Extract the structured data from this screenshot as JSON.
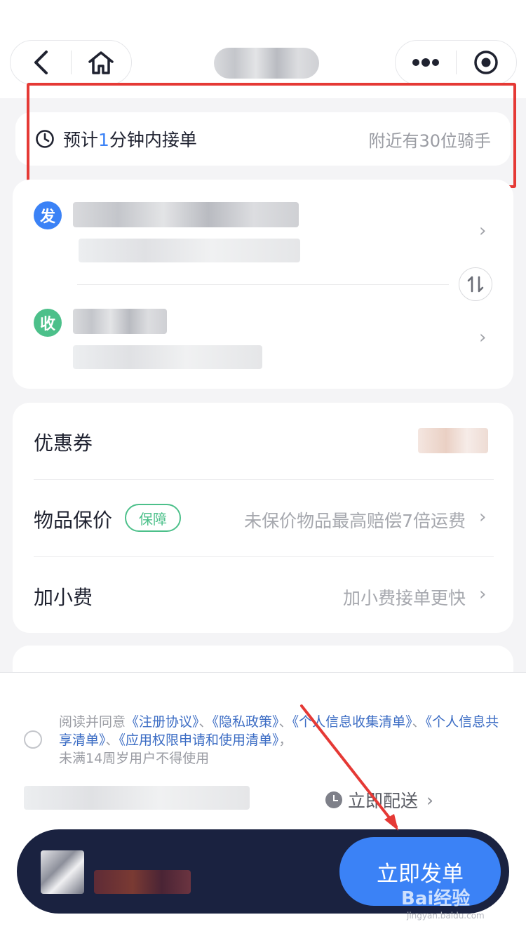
{
  "header": {
    "back_icon": "chevron-left-icon",
    "home_icon": "home-icon",
    "more_icon": "more-dots-icon",
    "target_icon": "target-icon"
  },
  "eta": {
    "prefix": "预计",
    "minutes": "1",
    "suffix": "分钟内接单",
    "nearby": "附近有30位骑手"
  },
  "address": {
    "send_badge": "发",
    "recv_badge": "收",
    "swap_icon": "swap-icon"
  },
  "options": {
    "coupon_label": "优惠券",
    "insurance_label": "物品保价",
    "insurance_tag": "保障",
    "insurance_hint": "未保价物品最高赔偿7倍运费",
    "tip_label": "加小费",
    "tip_hint": "加小费接单更快"
  },
  "agreement": {
    "lead": "阅读并同意",
    "link1": "《注册协议》",
    "sep1": "、",
    "link2": "《隐私政策》",
    "sep2": "、",
    "link3": "《个人信息收集清单》",
    "sep3": "、",
    "link4": "《个人信息共享清单》",
    "sep4": "、",
    "link5": "《应用权限申请和使用清单》",
    "tail": "，",
    "note": "未满14周岁用户不得使用"
  },
  "delivery": {
    "schedule_label": "立即配送",
    "submit_label": "立即发单"
  },
  "watermark": {
    "brand": "Bai经验",
    "site": "jingyan.baidu.com"
  },
  "colors": {
    "accent": "#3b82f6",
    "green": "#4cc08a",
    "dock": "#1a2240",
    "annotation": "#e53935"
  }
}
